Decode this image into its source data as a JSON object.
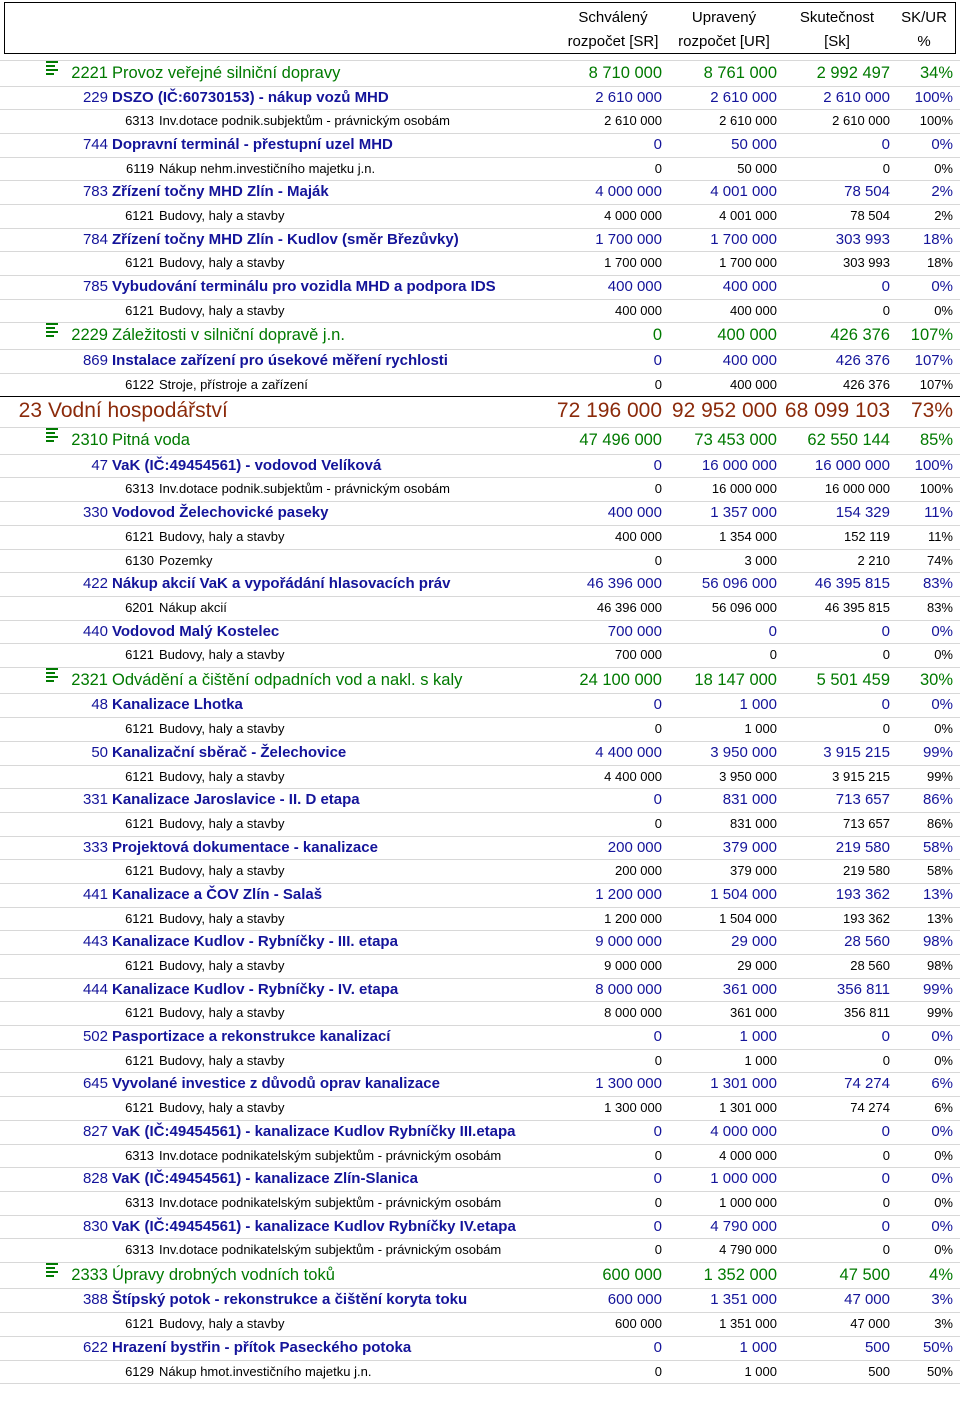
{
  "header": {
    "col1": [
      "Schválený",
      "rozpočet [SR]"
    ],
    "col2": [
      "Upravený",
      "rozpočet [UR]"
    ],
    "col3": [
      "Skutečnost",
      "[Sk]"
    ],
    "col4": [
      "SK/UR",
      "%"
    ]
  },
  "rows": [
    {
      "t": "para",
      "code": "2221",
      "name": "Provoz veřejné silniční dopravy",
      "sr": "8 710 000",
      "ur": "8 761 000",
      "sk": "2 992 497",
      "pct": "34%"
    },
    {
      "t": "akce",
      "code": "229",
      "name": "DSZO (IČ:60730153) - nákup vozů MHD",
      "sr": "2 610 000",
      "ur": "2 610 000",
      "sk": "2 610 000",
      "pct": "100%"
    },
    {
      "t": "item",
      "code": "6313",
      "name": "Inv.dotace podnik.subjektům - právnickým osobám",
      "sr": "2 610 000",
      "ur": "2 610 000",
      "sk": "2 610 000",
      "pct": "100%"
    },
    {
      "t": "akce",
      "code": "744",
      "name": "Dopravní terminál - přestupní uzel MHD",
      "sr": "0",
      "ur": "50 000",
      "sk": "0",
      "pct": "0%"
    },
    {
      "t": "item",
      "code": "6119",
      "name": "Nákup nehm.investičního majetku j.n.",
      "sr": "0",
      "ur": "50 000",
      "sk": "0",
      "pct": "0%"
    },
    {
      "t": "akce",
      "code": "783",
      "name": "Zřízení točny MHD Zlín - Maják",
      "sr": "4 000 000",
      "ur": "4 001 000",
      "sk": "78 504",
      "pct": "2%"
    },
    {
      "t": "item",
      "code": "6121",
      "name": "Budovy, haly a stavby",
      "sr": "4 000 000",
      "ur": "4 001 000",
      "sk": "78 504",
      "pct": "2%"
    },
    {
      "t": "akce",
      "code": "784",
      "name": "Zřízení točny MHD Zlín - Kudlov  (směr Březůvky)",
      "sr": "1 700 000",
      "ur": "1 700 000",
      "sk": "303 993",
      "pct": "18%"
    },
    {
      "t": "item",
      "code": "6121",
      "name": "Budovy, haly a stavby",
      "sr": "1 700 000",
      "ur": "1 700 000",
      "sk": "303 993",
      "pct": "18%"
    },
    {
      "t": "akce",
      "code": "785",
      "name": "Vybudování terminálu pro vozidla MHD a podpora IDS",
      "sr": "400 000",
      "ur": "400 000",
      "sk": "0",
      "pct": "0%"
    },
    {
      "t": "item",
      "code": "6121",
      "name": "Budovy, haly a stavby",
      "sr": "400 000",
      "ur": "400 000",
      "sk": "0",
      "pct": "0%"
    },
    {
      "t": "para",
      "code": "2229",
      "name": "Záležitosti v silniční dopravě j.n.",
      "sr": "0",
      "ur": "400 000",
      "sk": "426 376",
      "pct": "107%"
    },
    {
      "t": "akce",
      "code": "869",
      "name": "Instalace zařízení pro úsekové měření rychlosti",
      "sr": "0",
      "ur": "400 000",
      "sk": "426 376",
      "pct": "107%"
    },
    {
      "t": "item",
      "code": "6122",
      "name": "Stroje, přístroje a zařízení",
      "sr": "0",
      "ur": "400 000",
      "sk": "426 376",
      "pct": "107%",
      "sep": true
    },
    {
      "t": "sec",
      "code": "23",
      "name": "Vodní hospodářství",
      "sr": "72 196 000",
      "ur": "92 952 000",
      "sk": "68 099 103",
      "pct": "73%"
    },
    {
      "t": "para",
      "code": "2310",
      "name": "Pitná voda",
      "sr": "47 496 000",
      "ur": "73 453 000",
      "sk": "62 550 144",
      "pct": "85%"
    },
    {
      "t": "akce",
      "code": "47",
      "name": "VaK (IČ:49454561) - vodovod Velíková",
      "sr": "0",
      "ur": "16 000 000",
      "sk": "16 000 000",
      "pct": "100%"
    },
    {
      "t": "item",
      "code": "6313",
      "name": "Inv.dotace podnik.subjektům - právnickým osobám",
      "sr": "0",
      "ur": "16 000 000",
      "sk": "16 000 000",
      "pct": "100%"
    },
    {
      "t": "akce",
      "code": "330",
      "name": "Vodovod Želechovické paseky",
      "sr": "400 000",
      "ur": "1 357 000",
      "sk": "154 329",
      "pct": "11%"
    },
    {
      "t": "item",
      "code": "6121",
      "name": "Budovy, haly a stavby",
      "sr": "400 000",
      "ur": "1 354 000",
      "sk": "152 119",
      "pct": "11%"
    },
    {
      "t": "item",
      "code": "6130",
      "name": "Pozemky",
      "sr": "0",
      "ur": "3 000",
      "sk": "2 210",
      "pct": "74%"
    },
    {
      "t": "akce",
      "code": "422",
      "name": "Nákup akcií VaK a vypořádání hlasovacích práv",
      "sr": "46 396 000",
      "ur": "56 096 000",
      "sk": "46 395 815",
      "pct": "83%"
    },
    {
      "t": "item",
      "code": "6201",
      "name": "Nákup akcií",
      "sr": "46 396 000",
      "ur": "56 096 000",
      "sk": "46 395 815",
      "pct": "83%"
    },
    {
      "t": "akce",
      "code": "440",
      "name": "Vodovod Malý Kostelec",
      "sr": "700 000",
      "ur": "0",
      "sk": "0",
      "pct": "0%"
    },
    {
      "t": "item",
      "code": "6121",
      "name": "Budovy, haly a stavby",
      "sr": "700 000",
      "ur": "0",
      "sk": "0",
      "pct": "0%"
    },
    {
      "t": "para",
      "code": "2321",
      "name": "Odvádění a čištění odpadních vod a nakl. s kaly",
      "sr": "24 100 000",
      "ur": "18 147 000",
      "sk": "5 501 459",
      "pct": "30%"
    },
    {
      "t": "akce",
      "code": "48",
      "name": "Kanalizace Lhotka",
      "sr": "0",
      "ur": "1 000",
      "sk": "0",
      "pct": "0%"
    },
    {
      "t": "item",
      "code": "6121",
      "name": "Budovy, haly a stavby",
      "sr": "0",
      "ur": "1 000",
      "sk": "0",
      "pct": "0%"
    },
    {
      "t": "akce",
      "code": "50",
      "name": "Kanalizační sběrač - Želechovice",
      "sr": "4 400 000",
      "ur": "3 950 000",
      "sk": "3 915 215",
      "pct": "99%"
    },
    {
      "t": "item",
      "code": "6121",
      "name": "Budovy, haly a stavby",
      "sr": "4 400 000",
      "ur": "3 950 000",
      "sk": "3 915 215",
      "pct": "99%"
    },
    {
      "t": "akce",
      "code": "331",
      "name": "Kanalizace Jaroslavice - II. D etapa",
      "sr": "0",
      "ur": "831 000",
      "sk": "713 657",
      "pct": "86%"
    },
    {
      "t": "item",
      "code": "6121",
      "name": "Budovy, haly a stavby",
      "sr": "0",
      "ur": "831 000",
      "sk": "713 657",
      "pct": "86%"
    },
    {
      "t": "akce",
      "code": "333",
      "name": "Projektová dokumentace - kanalizace",
      "sr": "200 000",
      "ur": "379 000",
      "sk": "219 580",
      "pct": "58%"
    },
    {
      "t": "item",
      "code": "6121",
      "name": "Budovy, haly a stavby",
      "sr": "200 000",
      "ur": "379 000",
      "sk": "219 580",
      "pct": "58%"
    },
    {
      "t": "akce",
      "code": "441",
      "name": "Kanalizace a ČOV Zlín - Salaš",
      "sr": "1 200 000",
      "ur": "1 504 000",
      "sk": "193 362",
      "pct": "13%"
    },
    {
      "t": "item",
      "code": "6121",
      "name": "Budovy, haly a stavby",
      "sr": "1 200 000",
      "ur": "1 504 000",
      "sk": "193 362",
      "pct": "13%"
    },
    {
      "t": "akce",
      "code": "443",
      "name": "Kanalizace Kudlov - Rybníčky - III. etapa",
      "sr": "9 000 000",
      "ur": "29 000",
      "sk": "28 560",
      "pct": "98%"
    },
    {
      "t": "item",
      "code": "6121",
      "name": "Budovy, haly a stavby",
      "sr": "9 000 000",
      "ur": "29 000",
      "sk": "28 560",
      "pct": "98%"
    },
    {
      "t": "akce",
      "code": "444",
      "name": "Kanalizace Kudlov - Rybníčky - IV. etapa",
      "sr": "8 000 000",
      "ur": "361 000",
      "sk": "356 811",
      "pct": "99%"
    },
    {
      "t": "item",
      "code": "6121",
      "name": "Budovy, haly a stavby",
      "sr": "8 000 000",
      "ur": "361 000",
      "sk": "356 811",
      "pct": "99%"
    },
    {
      "t": "akce",
      "code": "502",
      "name": "Pasportizace a rekonstrukce kanalizací",
      "sr": "0",
      "ur": "1 000",
      "sk": "0",
      "pct": "0%"
    },
    {
      "t": "item",
      "code": "6121",
      "name": "Budovy, haly a stavby",
      "sr": "0",
      "ur": "1 000",
      "sk": "0",
      "pct": "0%"
    },
    {
      "t": "akce",
      "code": "645",
      "name": "Vyvolané investice z důvodů oprav kanalizace",
      "sr": "1 300 000",
      "ur": "1 301 000",
      "sk": "74 274",
      "pct": "6%"
    },
    {
      "t": "item",
      "code": "6121",
      "name": "Budovy, haly a stavby",
      "sr": "1 300 000",
      "ur": "1 301 000",
      "sk": "74 274",
      "pct": "6%"
    },
    {
      "t": "akce",
      "code": "827",
      "name": "VaK (IČ:49454561) - kanalizace Kudlov Rybníčky III.etapa",
      "sr": "0",
      "ur": "4 000 000",
      "sk": "0",
      "pct": "0%"
    },
    {
      "t": "item",
      "code": "6313",
      "name": "Inv.dotace podnikatelským subjektům - právnickým osobám",
      "sr": "0",
      "ur": "4 000 000",
      "sk": "0",
      "pct": "0%"
    },
    {
      "t": "akce",
      "code": "828",
      "name": "VaK (IČ:49454561) - kanalizace Zlín-Slanica",
      "sr": "0",
      "ur": "1 000 000",
      "sk": "0",
      "pct": "0%"
    },
    {
      "t": "item",
      "code": "6313",
      "name": "Inv.dotace podnikatelským subjektům - právnickým osobám",
      "sr": "0",
      "ur": "1 000 000",
      "sk": "0",
      "pct": "0%"
    },
    {
      "t": "akce",
      "code": "830",
      "name": "VaK (IČ:49454561) - kanalizace Kudlov Rybníčky IV.etapa",
      "sr": "0",
      "ur": "4 790 000",
      "sk": "0",
      "pct": "0%"
    },
    {
      "t": "item",
      "code": "6313",
      "name": "Inv.dotace podnikatelským subjektům - právnickým osobám",
      "sr": "0",
      "ur": "4 790 000",
      "sk": "0",
      "pct": "0%"
    },
    {
      "t": "para",
      "code": "2333",
      "name": "Úpravy drobných vodních toků",
      "sr": "600 000",
      "ur": "1 352 000",
      "sk": "47 500",
      "pct": "4%"
    },
    {
      "t": "akce",
      "code": "388",
      "name": "Štípský potok - rekonstrukce a čištění koryta toku",
      "sr": "600 000",
      "ur": "1 351 000",
      "sk": "47 000",
      "pct": "3%"
    },
    {
      "t": "item",
      "code": "6121",
      "name": "Budovy, haly a stavby",
      "sr": "600 000",
      "ur": "1 351 000",
      "sk": "47 000",
      "pct": "3%"
    },
    {
      "t": "akce",
      "code": "622",
      "name": "Hrazení bystřin - přítok Paseckého potoka",
      "sr": "0",
      "ur": "1 000",
      "sk": "500",
      "pct": "50%"
    },
    {
      "t": "item",
      "code": "6129",
      "name": "Nákup hmot.investičního majetku j.n.",
      "sr": "0",
      "ur": "1 000",
      "sk": "500",
      "pct": "50%"
    }
  ]
}
